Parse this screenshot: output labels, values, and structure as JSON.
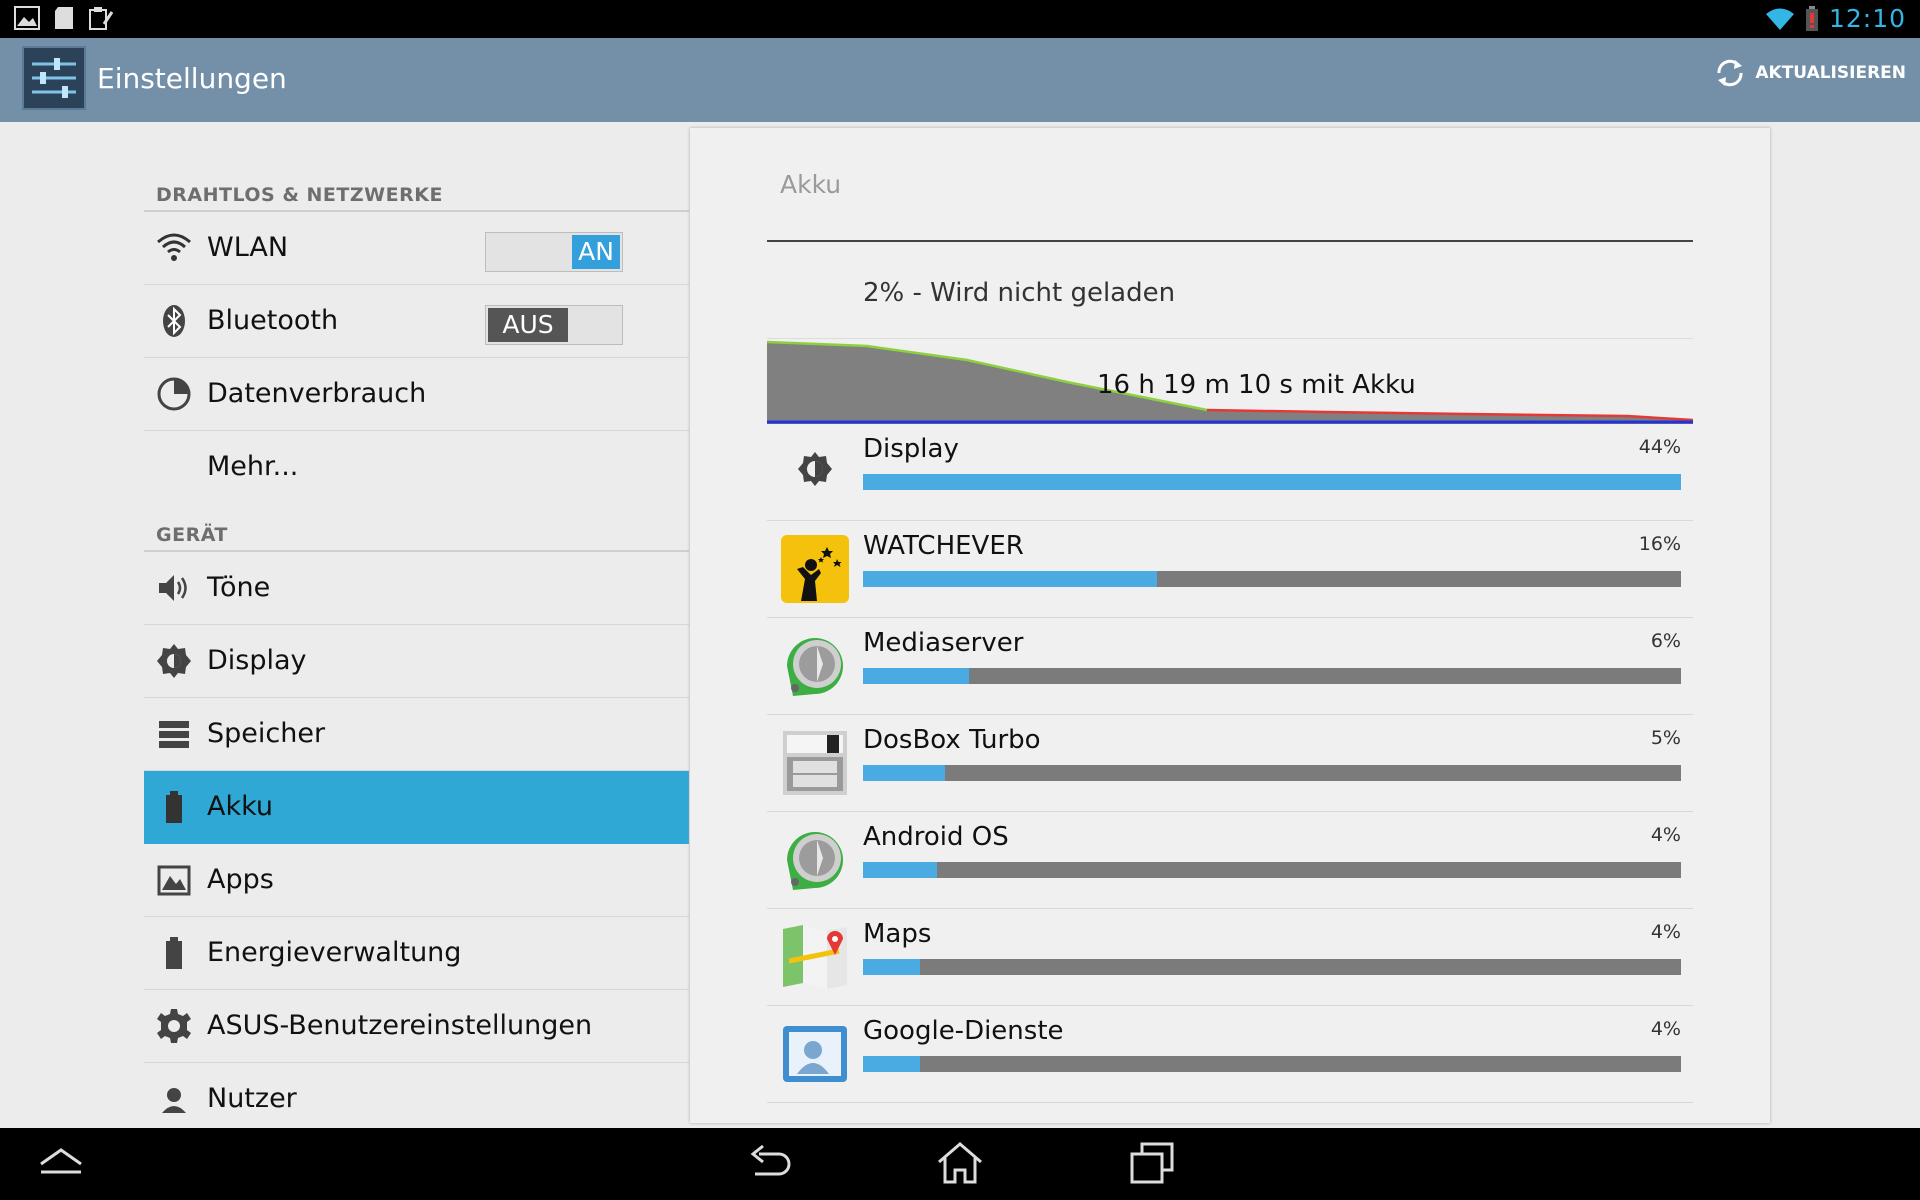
{
  "status": {
    "time": "12:10"
  },
  "actionbar": {
    "title": "Einstellungen",
    "refresh_label": "AKTUALISIEREN"
  },
  "sidebar": {
    "section_wireless": "DRAHTLOS & NETZWERKE",
    "wlan": {
      "label": "WLAN",
      "toggle": "AN"
    },
    "bluetooth": {
      "label": "Bluetooth",
      "toggle": "AUS"
    },
    "data_usage": "Datenverbrauch",
    "more": "Mehr...",
    "section_device": "GERÄT",
    "sound": "Töne",
    "display": "Display",
    "storage": "Speicher",
    "battery": "Akku",
    "apps": "Apps",
    "power": "Energieverwaltung",
    "asus": "ASUS-Benutzereinstellungen",
    "users": "Nutzer"
  },
  "panel": {
    "title": "Akku",
    "status": "2% - Wird nicht geladen",
    "graph_label": "16 h 19 m 10 s mit Akku",
    "usage": [
      {
        "name": "Display",
        "percent": "44%",
        "fill": 1.0
      },
      {
        "name": "WATCHEVER",
        "percent": "16%",
        "fill": 0.36
      },
      {
        "name": "Mediaserver",
        "percent": "6%",
        "fill": 0.13
      },
      {
        "name": "DosBox Turbo",
        "percent": "5%",
        "fill": 0.1
      },
      {
        "name": "Android OS",
        "percent": "4%",
        "fill": 0.09
      },
      {
        "name": "Maps",
        "percent": "4%",
        "fill": 0.07
      },
      {
        "name": "Google-Dienste",
        "percent": "4%",
        "fill": 0.07
      }
    ]
  },
  "colors": {
    "accent": "#33b5e5",
    "selected": "#2fa8d5",
    "actionbar": "#748fa8",
    "bar_fill": "#4aaae2"
  }
}
